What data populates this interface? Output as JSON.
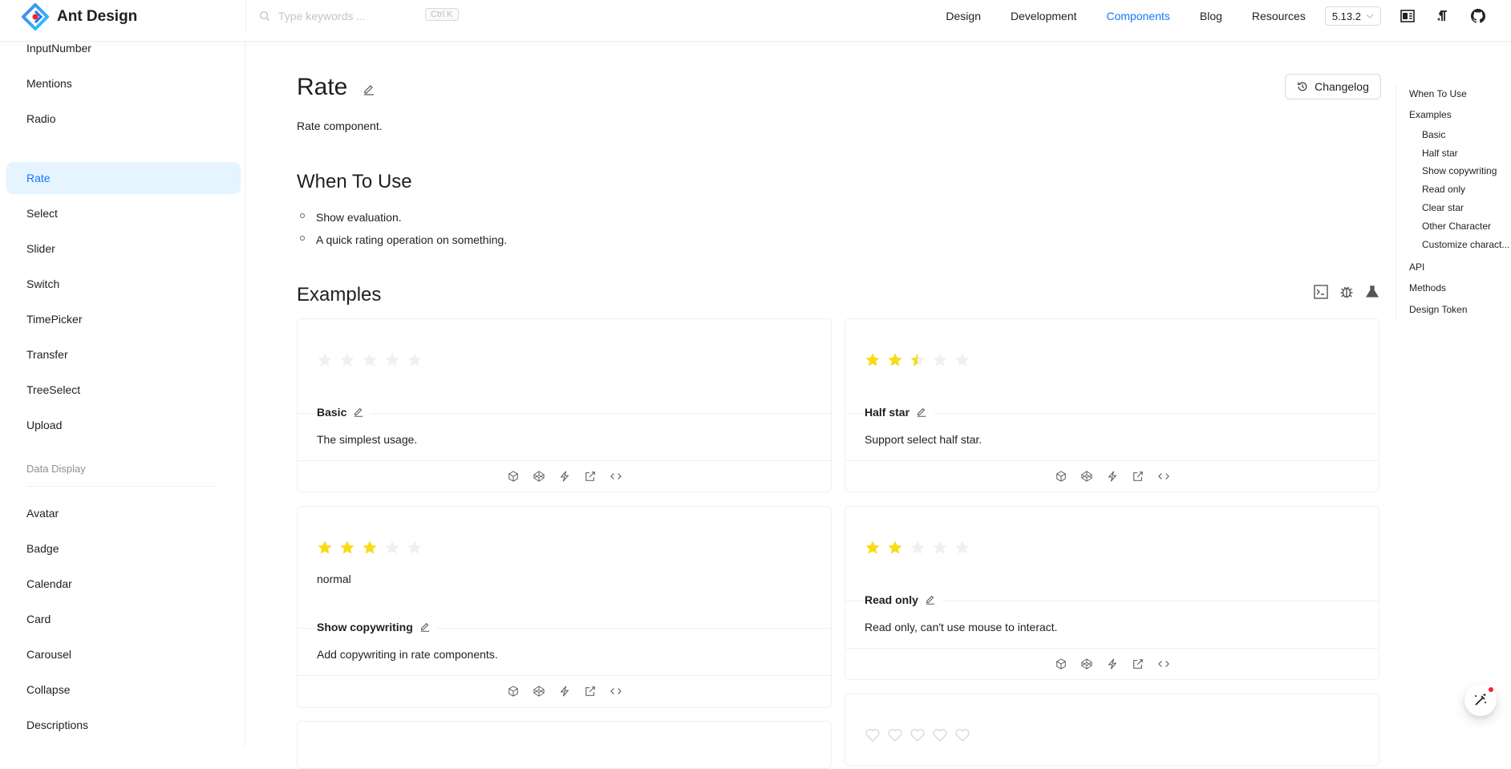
{
  "header": {
    "logo_text": "Ant Design",
    "search_placeholder": "Type keywords ...",
    "search_shortcut": "Ctrl K",
    "nav": [
      {
        "label": "Design",
        "active": false
      },
      {
        "label": "Development",
        "active": false
      },
      {
        "label": "Components",
        "active": true
      },
      {
        "label": "Blog",
        "active": false
      },
      {
        "label": "Resources",
        "active": false
      }
    ],
    "version": "5.13.2"
  },
  "sidebar": {
    "items_top": [
      "InputNumber",
      "Mentions",
      "Radio",
      "Rate",
      "Select",
      "Slider",
      "Switch",
      "TimePicker",
      "Transfer",
      "TreeSelect",
      "Upload"
    ],
    "active": "Rate",
    "group_label": "Data Display",
    "items_bottom": [
      "Avatar",
      "Badge",
      "Calendar",
      "Card",
      "Carousel",
      "Collapse",
      "Descriptions"
    ]
  },
  "page": {
    "title": "Rate",
    "changelog_label": "Changelog",
    "description": "Rate component.",
    "when_heading": "When To Use",
    "when_bullets": [
      "Show evaluation.",
      "A quick rating operation on something."
    ],
    "examples_heading": "Examples"
  },
  "examples": [
    {
      "title": "Basic",
      "desc": "The simplest usage.",
      "note": "",
      "rating": 0
    },
    {
      "title": "Half star",
      "desc": "Support select half star.",
      "note": "",
      "rating": 2.5
    },
    {
      "title": "Show copywriting",
      "desc": "Add copywriting in rate components.",
      "note": "normal",
      "rating": 3
    },
    {
      "title": "Read only",
      "desc": "Read only, can't use mouse to interact.",
      "note": "",
      "rating": 2
    }
  ],
  "toc": {
    "items": [
      {
        "label": "When To Use",
        "level": 1
      },
      {
        "label": "Examples",
        "level": 1
      },
      {
        "label": "Basic",
        "level": 2
      },
      {
        "label": "Half star",
        "level": 2
      },
      {
        "label": "Show copywriting",
        "level": 2
      },
      {
        "label": "Read only",
        "level": 2
      },
      {
        "label": "Clear star",
        "level": 2
      },
      {
        "label": "Other Character",
        "level": 2
      },
      {
        "label": "Customize charact...",
        "level": 2
      },
      {
        "label": "API",
        "level": 1
      },
      {
        "label": "Methods",
        "level": 1
      },
      {
        "label": "Design Token",
        "level": 1
      }
    ]
  },
  "colors": {
    "primary": "#1677ff",
    "star": "#fadb14",
    "star_empty": "#f0f0f0"
  }
}
